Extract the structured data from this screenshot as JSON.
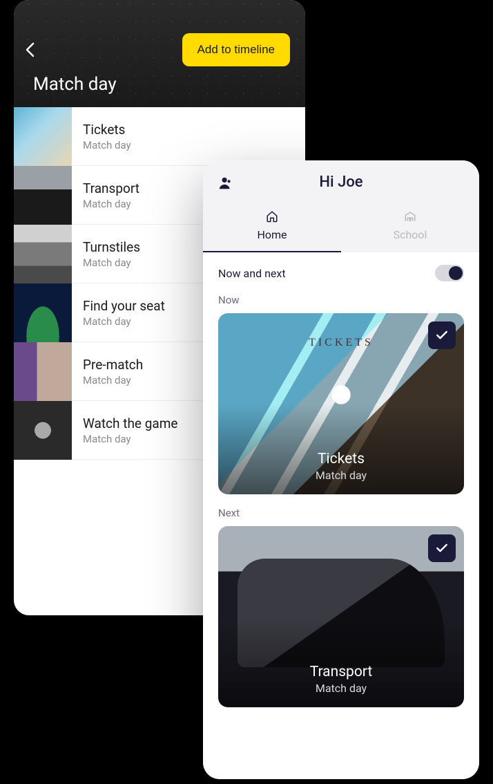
{
  "left": {
    "title": "Match day",
    "add_button": "Add to timeline",
    "items": [
      {
        "title": "Tickets",
        "sub": "Match day"
      },
      {
        "title": "Transport",
        "sub": "Match day"
      },
      {
        "title": "Turnstiles",
        "sub": "Match day"
      },
      {
        "title": "Find your seat",
        "sub": "Match day"
      },
      {
        "title": "Pre-match",
        "sub": "Match day"
      },
      {
        "title": "Watch the game",
        "sub": "Match day"
      }
    ]
  },
  "right": {
    "greeting": "Hi Joe",
    "tabs": {
      "home": "Home",
      "school": "School"
    },
    "now_next_label": "Now and next",
    "sections": {
      "now_label": "Now",
      "now_card": {
        "title": "Tickets",
        "sub": "Match day",
        "overlay": "TICKETS"
      },
      "next_label": "Next",
      "next_card": {
        "title": "Transport",
        "sub": "Match day"
      }
    }
  }
}
